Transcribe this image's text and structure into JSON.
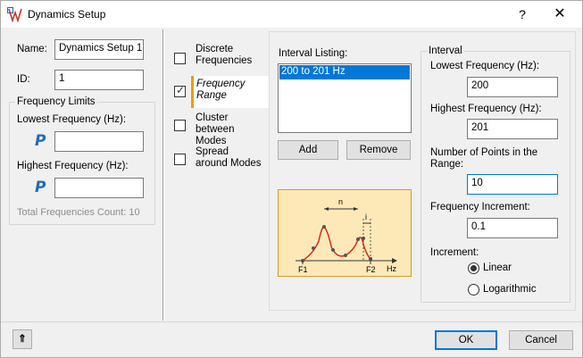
{
  "window": {
    "title": "Dynamics Setup",
    "help_label": "?",
    "close_label": "✕"
  },
  "setup": {
    "name_label": "Name:",
    "name_value": "Dynamics Setup 1",
    "id_label": "ID:",
    "id_value": "1"
  },
  "freq_limits": {
    "title": "Frequency Limits",
    "lowest_label": "Lowest Frequency (Hz):",
    "lowest_value": "",
    "highest_label": "Highest Frequency (Hz):",
    "highest_value": "",
    "param_glyph": "P",
    "total_count_text": "Total Frequencies Count: 10"
  },
  "tabs": [
    {
      "label": "Discrete Frequencies",
      "checked": false
    },
    {
      "label": "Frequency Range",
      "checked": true
    },
    {
      "label": "Cluster between Modes",
      "checked": false
    },
    {
      "label": "Spread around Modes",
      "checked": false
    }
  ],
  "interval_listing": {
    "label": "Interval Listing:",
    "items": [
      "200 to 201 Hz"
    ],
    "add_label": "Add",
    "remove_label": "Remove"
  },
  "diagram": {
    "n_label": "n",
    "i_label": "i",
    "hz_label": "Hz",
    "f1_label": "F1",
    "f2_label": "F2",
    "curve_color": "#d8281e",
    "bg_color": "#fde9b8",
    "border_color": "#d09a2a"
  },
  "interval": {
    "title": "Interval",
    "lowest_label": "Lowest Frequency (Hz):",
    "lowest_value": "200",
    "highest_label": "Highest Frequency (Hz):",
    "highest_value": "201",
    "points_label_line1": "Number of Points in the",
    "points_label_line2": "Range:",
    "points_value": "10",
    "increment_label": "Frequency Increment:",
    "increment_value": "0.1",
    "increment_type_label": "Increment:",
    "linear_label": "Linear",
    "log_label": "Logarithmic",
    "selected": "Linear"
  },
  "footer": {
    "expand_glyph": "⇑",
    "ok_label": "OK",
    "cancel_label": "Cancel"
  },
  "colors": {
    "selection": "#0078d7",
    "accent_tab": "#e8a000"
  }
}
